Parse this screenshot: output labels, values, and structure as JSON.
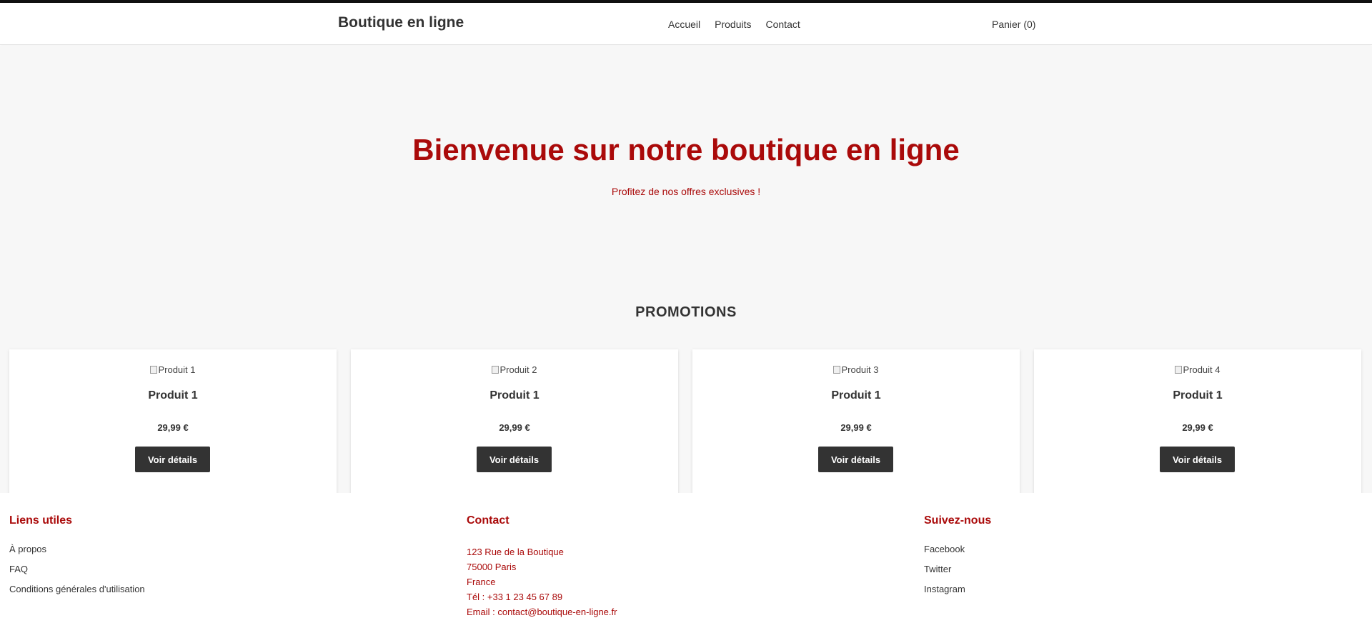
{
  "header": {
    "logo": "Boutique en ligne",
    "nav": [
      "Accueil",
      "Produits",
      "Contact"
    ],
    "cart": "Panier (0)"
  },
  "hero": {
    "title": "Bienvenue sur notre boutique en ligne",
    "subtitle": "Profitez de nos offres exclusives !"
  },
  "promotions": {
    "title": "PROMOTIONS",
    "products": [
      {
        "image_alt": "Produit 1",
        "name": "Produit 1",
        "price": "29,99 €",
        "button": "Voir détails"
      },
      {
        "image_alt": "Produit 2",
        "name": "Produit 1",
        "price": "29,99 €",
        "button": "Voir détails"
      },
      {
        "image_alt": "Produit 3",
        "name": "Produit 1",
        "price": "29,99 €",
        "button": "Voir détails"
      },
      {
        "image_alt": "Produit 4",
        "name": "Produit 1",
        "price": "29,99 €",
        "button": "Voir détails"
      }
    ]
  },
  "footer": {
    "links": {
      "title": "Liens utiles",
      "items": [
        "À propos",
        "FAQ",
        "Conditions générales d'utilisation"
      ]
    },
    "contact": {
      "title": "Contact",
      "lines": [
        "123 Rue de la Boutique",
        "75000 Paris",
        "France",
        "Tél : +33 1 23 45 67 89",
        "Email : contact@boutique-en-ligne.fr"
      ]
    },
    "social": {
      "title": "Suivez-nous",
      "items": [
        "Facebook",
        "Twitter",
        "Instagram"
      ]
    }
  },
  "colors": {
    "accent": "#aa0a0a",
    "dark": "#333333",
    "background": "#f7f7f7"
  },
  "icons": {
    "broken_image": "broken-image-icon"
  }
}
